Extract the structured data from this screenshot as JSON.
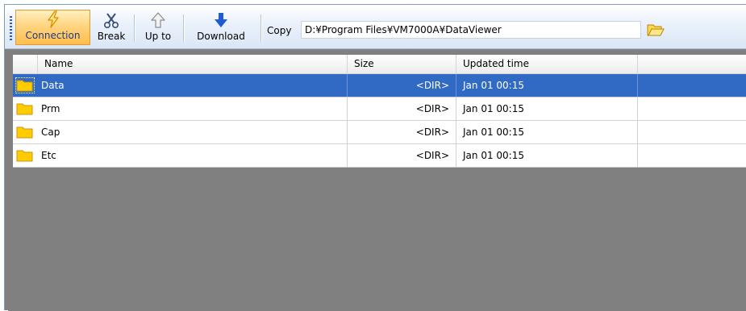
{
  "toolbar": {
    "buttons": [
      {
        "label": "Connection",
        "icon": "lightning-icon",
        "active": true
      },
      {
        "label": "Break",
        "icon": "scissors-icon"
      },
      {
        "label": "Up to",
        "icon": "arrow-up-icon"
      },
      {
        "label": "Download",
        "icon": "arrow-down-icon"
      }
    ],
    "copy_label": "Copy",
    "path_value": "D:¥Program Files¥VM7000A¥DataViewer",
    "open_folder_icon": "folder-open-icon"
  },
  "list": {
    "columns": [
      "Name",
      "Size",
      "Updated time"
    ],
    "rows": [
      {
        "name": "Data",
        "size": "<DIR>",
        "updated": "Jan 01 00:15",
        "selected": true
      },
      {
        "name": "Prm",
        "size": "<DIR>",
        "updated": "Jan 01 00:15"
      },
      {
        "name": "Cap",
        "size": "<DIR>",
        "updated": "Jan 01 00:15"
      },
      {
        "name": "Etc",
        "size": "<DIR>",
        "updated": "Jan 01 00:15"
      }
    ],
    "row_icon": "folder-icon"
  },
  "colors": {
    "selection": "#316ac5",
    "toolbar_active": "#ffbe4f",
    "empty_area": "#808080",
    "folder": "#ffcc00"
  }
}
